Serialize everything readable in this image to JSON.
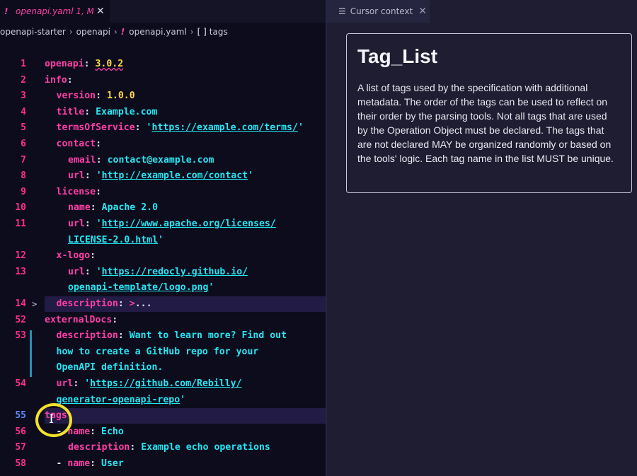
{
  "editor": {
    "tab": {
      "label": "openapi.yaml 1, M",
      "icon": "!"
    },
    "breadcrumb": {
      "items": [
        "openapi-starter",
        "openapi",
        "openapi.yaml",
        "tags"
      ],
      "file_icon": "!",
      "symbol_icon": "[ ]"
    },
    "lines": [
      {
        "num": "1",
        "indent": 0,
        "parts": [
          [
            "k",
            "openapi"
          ],
          [
            "p",
            ": "
          ],
          [
            "n",
            "3.0.2"
          ]
        ],
        "squiggle": true
      },
      {
        "num": "2",
        "indent": 0,
        "parts": [
          [
            "k",
            "info"
          ],
          [
            "p",
            ":"
          ]
        ]
      },
      {
        "num": "3",
        "indent": 1,
        "parts": [
          [
            "k",
            "version"
          ],
          [
            "p",
            ": "
          ],
          [
            "n",
            "1.0.0"
          ]
        ]
      },
      {
        "num": "4",
        "indent": 1,
        "parts": [
          [
            "k",
            "title"
          ],
          [
            "p",
            ": "
          ],
          [
            "s",
            "Example.com"
          ]
        ]
      },
      {
        "num": "5",
        "indent": 1,
        "parts": [
          [
            "k",
            "termsOfService"
          ],
          [
            "p",
            ": "
          ],
          [
            "sq",
            "'"
          ],
          [
            "u",
            "https://example.com/terms/"
          ],
          [
            "sq",
            "'"
          ]
        ]
      },
      {
        "num": "6",
        "indent": 1,
        "parts": [
          [
            "k",
            "contact"
          ],
          [
            "p",
            ":"
          ]
        ]
      },
      {
        "num": "7",
        "indent": 2,
        "parts": [
          [
            "k",
            "email"
          ],
          [
            "p",
            ": "
          ],
          [
            "s",
            "contact@example.com"
          ]
        ]
      },
      {
        "num": "8",
        "indent": 2,
        "parts": [
          [
            "k",
            "url"
          ],
          [
            "p",
            ": "
          ],
          [
            "sq",
            "'"
          ],
          [
            "u",
            "http://example.com/contact"
          ],
          [
            "sq",
            "'"
          ]
        ]
      },
      {
        "num": "9",
        "indent": 1,
        "parts": [
          [
            "k",
            "license"
          ],
          [
            "p",
            ":"
          ]
        ]
      },
      {
        "num": "10",
        "indent": 2,
        "parts": [
          [
            "k",
            "name"
          ],
          [
            "p",
            ": "
          ],
          [
            "s",
            "Apache 2.0"
          ]
        ]
      },
      {
        "num": "11",
        "indent": 2,
        "parts": [
          [
            "k",
            "url"
          ],
          [
            "p",
            ": "
          ],
          [
            "sq",
            "'"
          ],
          [
            "u",
            "http://www.apache.org/licenses/"
          ]
        ]
      },
      {
        "num": "",
        "indent": 2,
        "parts": [
          [
            "u",
            "LICENSE-2.0.html"
          ],
          [
            "sq",
            "'"
          ]
        ]
      },
      {
        "num": "12",
        "indent": 1,
        "parts": [
          [
            "k",
            "x-logo"
          ],
          [
            "p",
            ":"
          ]
        ]
      },
      {
        "num": "13",
        "indent": 2,
        "parts": [
          [
            "k",
            "url"
          ],
          [
            "p",
            ": "
          ],
          [
            "sq",
            "'"
          ],
          [
            "u",
            "https://redocly.github.io/"
          ]
        ]
      },
      {
        "num": "",
        "indent": 2,
        "parts": [
          [
            "u",
            "openapi-template/logo.png"
          ],
          [
            "sq",
            "'"
          ]
        ]
      },
      {
        "num": "14",
        "indent": 1,
        "fold": ">",
        "highlight": true,
        "parts": [
          [
            "k",
            "description"
          ],
          [
            "p",
            ": "
          ],
          [
            "k",
            ">"
          ],
          [
            "p",
            "..."
          ]
        ]
      },
      {
        "num": "52",
        "indent": 0,
        "parts": [
          [
            "k",
            "externalDocs"
          ],
          [
            "p",
            ":"
          ]
        ]
      },
      {
        "num": "53",
        "indent": 1,
        "parts": [
          [
            "k",
            "description"
          ],
          [
            "p",
            ": "
          ],
          [
            "s",
            "Want to learn more? Find out"
          ]
        ]
      },
      {
        "num": "",
        "indent": 1,
        "parts": [
          [
            "s",
            "how to create a GitHub repo for your"
          ]
        ]
      },
      {
        "num": "",
        "indent": 1,
        "parts": [
          [
            "s",
            "OpenAPI definition."
          ]
        ]
      },
      {
        "num": "54",
        "indent": 1,
        "parts": [
          [
            "k",
            "url"
          ],
          [
            "p",
            ": "
          ],
          [
            "sq",
            "'"
          ],
          [
            "u",
            "https://github.com/Rebilly/"
          ]
        ]
      },
      {
        "num": "",
        "indent": 1,
        "parts": [
          [
            "u",
            "generator-openapi-repo"
          ],
          [
            "sq",
            "'"
          ]
        ]
      },
      {
        "num": "55",
        "indent": 0,
        "current": true,
        "highlight": true,
        "parts": [
          [
            "k",
            "tags"
          ],
          [
            "p",
            ":"
          ]
        ]
      },
      {
        "num": "56",
        "indent": 1,
        "parts": [
          [
            "p",
            "- "
          ],
          [
            "k",
            "name"
          ],
          [
            "p",
            ": "
          ],
          [
            "s",
            "Echo"
          ]
        ]
      },
      {
        "num": "57",
        "indent": 2,
        "parts": [
          [
            "k",
            "description"
          ],
          [
            "p",
            ": "
          ],
          [
            "s",
            "Example echo operations"
          ]
        ]
      },
      {
        "num": "58",
        "indent": 1,
        "parts": [
          [
            "p",
            "- "
          ],
          [
            "k",
            "name"
          ],
          [
            "p",
            ": "
          ],
          [
            "s",
            "User"
          ]
        ]
      }
    ]
  },
  "context_panel": {
    "tab_label": "Cursor context",
    "title": "Tag_List",
    "body": "A list of tags used by the specification with additional metadata. The order of the tags can be used to reflect on their order by the parsing tools. Not all tags that are used by the Operation Object must be declared. The tags that are not declared MAY be organized randomly or based on the tools' logic. Each tag name in the list MUST be unique."
  },
  "colors": {
    "key": "#ff3ea5",
    "number": "#ffd53d",
    "string": "#26e5f2",
    "line_number": "#ff2e88",
    "current_line_number": "#5a8cff",
    "cursor_highlight": "#f4e12a"
  }
}
